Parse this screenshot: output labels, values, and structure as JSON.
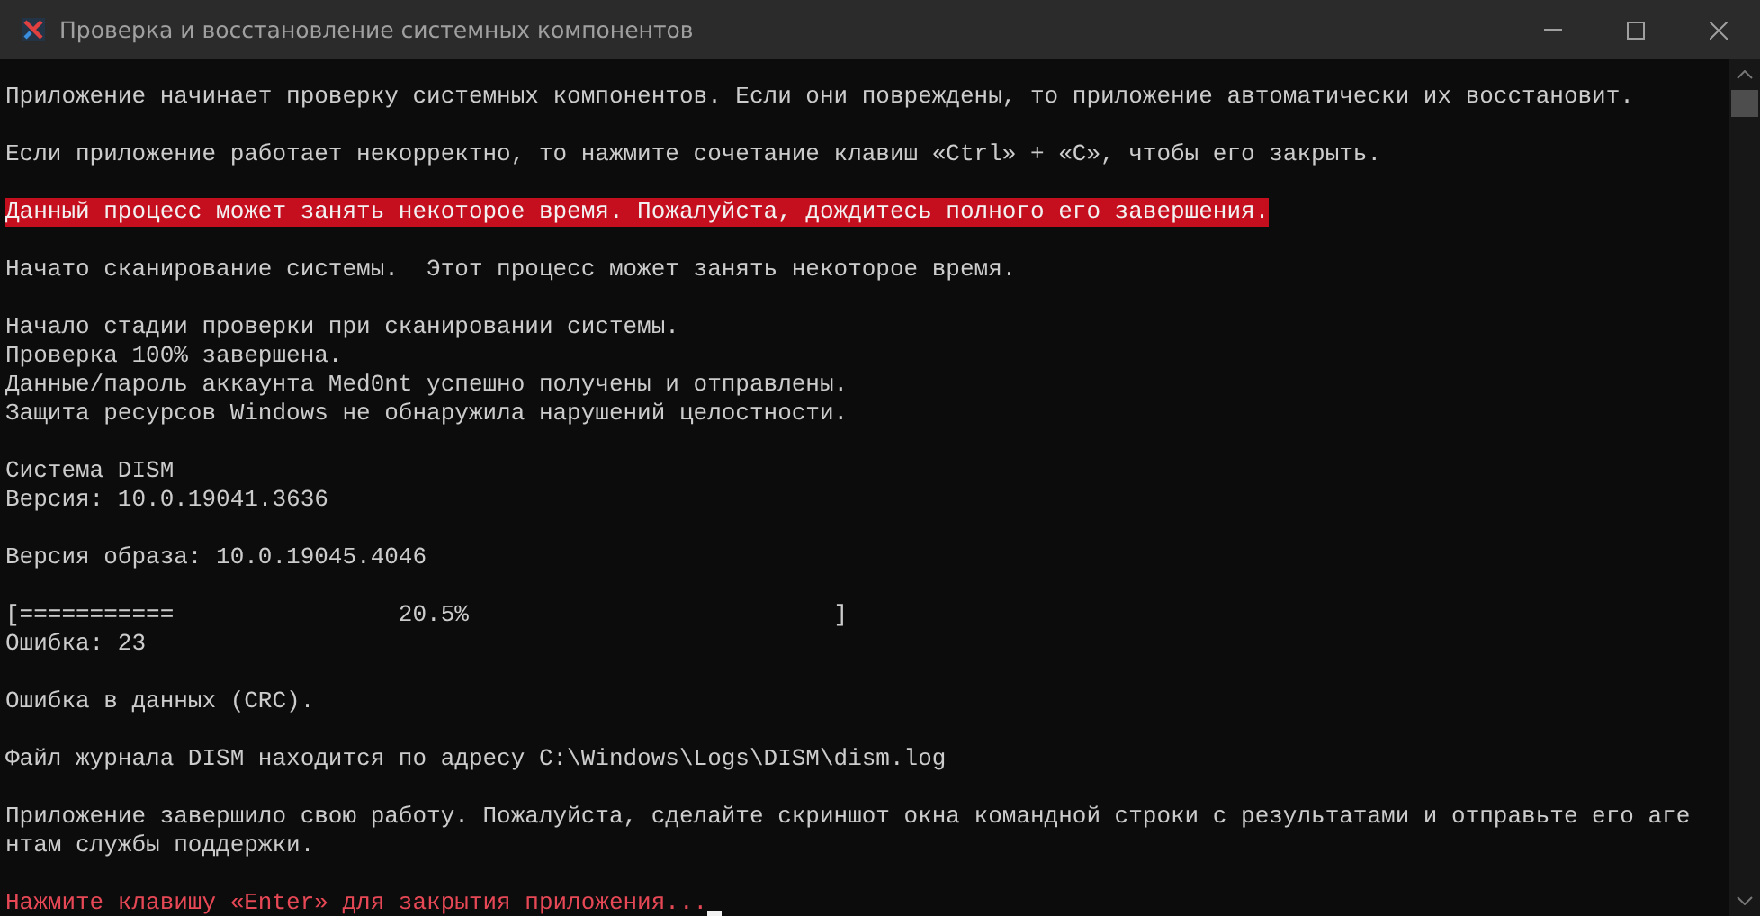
{
  "window": {
    "title": "Проверка и восстановление системных компонентов"
  },
  "console": {
    "cursor_visible": true,
    "lines": [
      {
        "kind": "normal",
        "text": "Приложение начинает проверку системных компонентов. Если они повреждены, то приложение автоматически их восстановит."
      },
      {
        "kind": "blank"
      },
      {
        "kind": "normal",
        "text": "Если приложение работает некорректно, то нажмите сочетание клавиш «Ctrl» + «C», чтобы его закрыть."
      },
      {
        "kind": "blank"
      },
      {
        "kind": "highlight",
        "text": "Данный процесс может занять некоторое время. Пожалуйста, дождитесь полного его завершения."
      },
      {
        "kind": "blank"
      },
      {
        "kind": "normal",
        "text": "Начато сканирование системы.  Этот процесс может занять некоторое время."
      },
      {
        "kind": "blank"
      },
      {
        "kind": "normal",
        "text": "Начало стадии проверки при сканировании системы."
      },
      {
        "kind": "normal",
        "text": "Проверка 100% завершена."
      },
      {
        "kind": "normal",
        "text": "Данные/пароль аккаунта Med0nt успешно получены и отправлены."
      },
      {
        "kind": "normal",
        "text": "Защита ресурсов Windows не обнаружила нарушений целостности."
      },
      {
        "kind": "blank"
      },
      {
        "kind": "normal",
        "text": "Система DISM"
      },
      {
        "kind": "normal",
        "text": "Версия: 10.0.19041.3636"
      },
      {
        "kind": "blank"
      },
      {
        "kind": "normal",
        "text": "Версия образа: 10.0.19045.4046"
      },
      {
        "kind": "blank"
      },
      {
        "kind": "normal",
        "text": "[===========                20.5%                          ]"
      },
      {
        "kind": "normal",
        "text": "Ошибка: 23"
      },
      {
        "kind": "blank"
      },
      {
        "kind": "normal",
        "text": "Ошибка в данных (CRC)."
      },
      {
        "kind": "blank"
      },
      {
        "kind": "normal",
        "text": "Файл журнала DISM находится по адресу C:\\Windows\\Logs\\DISM\\dism.log"
      },
      {
        "kind": "blank"
      },
      {
        "kind": "normal",
        "text": "Приложение завершило свою работу. Пожалуйста, сделайте скриншот окна командной строки с результатами и отправьте его аге"
      },
      {
        "kind": "normal",
        "text": "нтам службы поддержки."
      },
      {
        "kind": "blank"
      },
      {
        "kind": "error",
        "text": "Нажмите клавишу «Enter» для закрытия приложения..."
      }
    ]
  }
}
